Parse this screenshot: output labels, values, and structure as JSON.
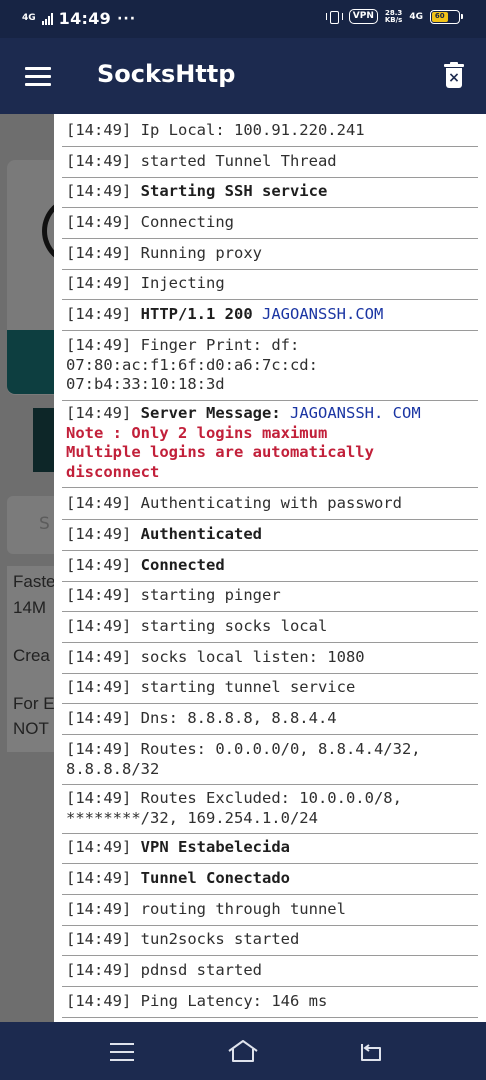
{
  "status_bar": {
    "network": "4G",
    "time": "14:49",
    "dots": "···",
    "vpn": "VPN",
    "speed_value": "28.3",
    "speed_unit": "KB/s",
    "network_right": "4G",
    "battery_level": 60,
    "battery_label": "60",
    "battery_color": "#f2c318"
  },
  "app_bar": {
    "title": "SocksHttp",
    "menu_icon": "hamburger-menu-icon",
    "clear_icon": "trash-clear-icon"
  },
  "background": {
    "box_text": "S",
    "lines": [
      "Faste",
      "14M",
      "Crea",
      "For E",
      "NOT"
    ]
  },
  "log": {
    "entries": [
      {
        "time": "[14:49]",
        "text": "Ip Local: 100.91.220.241"
      },
      {
        "time": "[14:49]",
        "text": "started Tunnel Thread"
      },
      {
        "time": "[14:49]",
        "text": "Starting SSH service"
      },
      {
        "time": "[14:49]",
        "text": "Connecting"
      },
      {
        "time": "[14:49]",
        "text": "Running proxy"
      },
      {
        "time": "[14:49]",
        "text": "Injecting"
      },
      {
        "time": "[14:49]",
        "text": "HTTP/1.1 200",
        "extra": "JAGOANSSH.COM"
      },
      {
        "time": "[14:49]",
        "text": "Finger Print: df:",
        "line2": "07:80:ac:f1:6f:d0:a6:7c:cd:",
        "line3": "07:b4:33:10:18:3d"
      },
      {
        "time": "[14:49]",
        "text": "Server Message:",
        "extra": "JAGOANSSH. COM",
        "note1": "Note : Only 2 logins maximum",
        "note2": "Multiple logins are automatically",
        "note3": "disconnect"
      },
      {
        "time": "[14:49]",
        "text": "Authenticating with password"
      },
      {
        "time": "[14:49]",
        "text": "Authenticated"
      },
      {
        "time": "[14:49]",
        "text": "Connected"
      },
      {
        "time": "[14:49]",
        "text": "starting pinger"
      },
      {
        "time": "[14:49]",
        "text": "starting socks local"
      },
      {
        "time": "[14:49]",
        "text": "socks local listen: 1080"
      },
      {
        "time": "[14:49]",
        "text": "starting tunnel service"
      },
      {
        "time": "[14:49]",
        "text": "Dns: 8.8.8.8, 8.8.4.4"
      },
      {
        "time": "[14:49]",
        "text": "Routes: 0.0.0.0/0, 8.8.4.4/32,",
        "line2": "8.8.8.8/32"
      },
      {
        "time": "[14:49]",
        "text": "Routes Excluded: 10.0.0.0/8,",
        "line2": "********/32, 169.254.1.0/24"
      },
      {
        "time": "[14:49]",
        "text": "VPN Estabelecida"
      },
      {
        "time": "[14:49]",
        "text": "Tunnel Conectado"
      },
      {
        "time": "[14:49]",
        "text": "routing through tunnel"
      },
      {
        "time": "[14:49]",
        "text": "tun2socks started"
      },
      {
        "time": "[14:49]",
        "text": "pdnsd started"
      },
      {
        "time": "[14:49]",
        "text": "Ping Latency: 146 ms"
      }
    ]
  },
  "nav_bar": {
    "menu_icon": "recent-apps-icon",
    "home_icon": "home-icon",
    "back_icon": "back-icon"
  }
}
